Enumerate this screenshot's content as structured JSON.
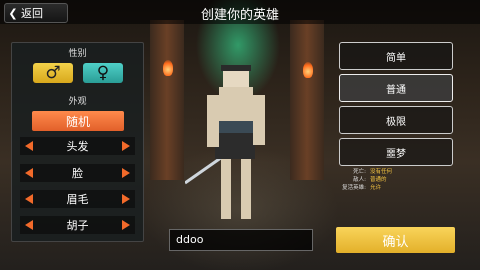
{
  "header": {
    "back_label": "返回",
    "title": "创建你的英雄"
  },
  "appearance_panel": {
    "gender_heading": "性别",
    "male_symbol": "♂",
    "female_symbol": "♀",
    "appearance_heading": "外观",
    "random_label": "随机",
    "options": [
      {
        "label": "头发"
      },
      {
        "label": "脸"
      },
      {
        "label": "眉毛"
      },
      {
        "label": "胡子"
      }
    ]
  },
  "difficulty": {
    "options": [
      "简单",
      "普通",
      "极限",
      "噩梦"
    ],
    "selected": "普通",
    "info": [
      {
        "label": "死亡:",
        "value": "没有任何"
      },
      {
        "label": "敌人:",
        "value": "普通的"
      },
      {
        "label": "复活英雄:",
        "value": "允许"
      }
    ]
  },
  "name_input": {
    "value": "ddoo"
  },
  "confirm_label": "确认",
  "colors": {
    "accent_orange": "#f26a2a",
    "confirm_yellow": "#f0c040",
    "male_yellow": "#f3d24a",
    "female_teal": "#4fd0c8"
  }
}
